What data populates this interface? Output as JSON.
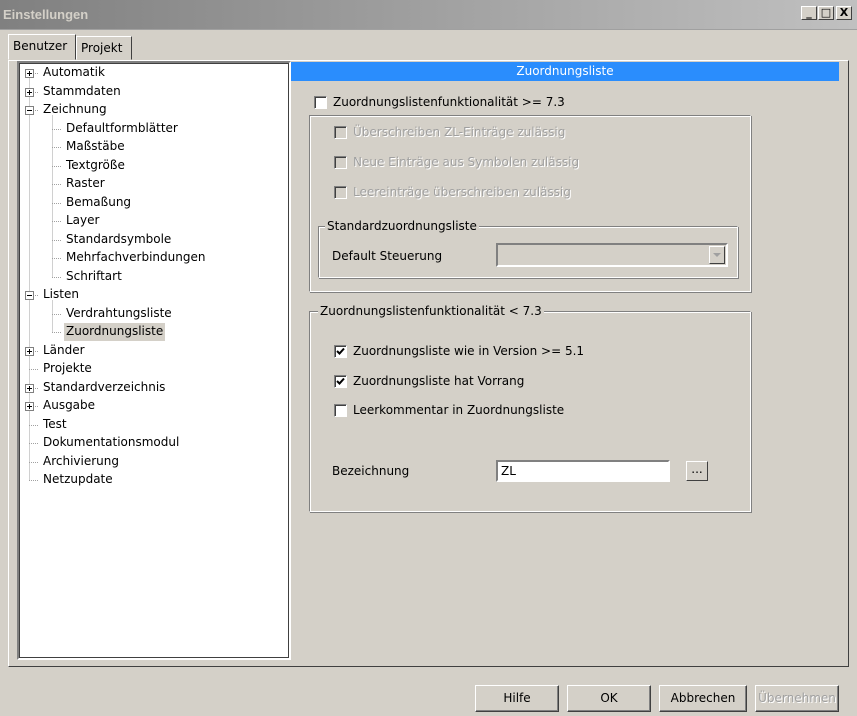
{
  "window": {
    "title": "Einstellungen",
    "controls": {
      "minimize": "_",
      "maximize": "□",
      "close": "X"
    }
  },
  "tabs": [
    {
      "label": "Benutzer",
      "active": true
    },
    {
      "label": "Projekt",
      "active": false
    }
  ],
  "tree": {
    "items": [
      {
        "label": "Automatik",
        "level": 0,
        "expander": "plus"
      },
      {
        "label": "Stammdaten",
        "level": 0,
        "expander": "plus"
      },
      {
        "label": "Zeichnung",
        "level": 0,
        "expander": "minus"
      },
      {
        "label": "Defaultformblätter",
        "level": 1,
        "expander": "none"
      },
      {
        "label": "Maßstäbe",
        "level": 1,
        "expander": "none"
      },
      {
        "label": "Textgröße",
        "level": 1,
        "expander": "none"
      },
      {
        "label": "Raster",
        "level": 1,
        "expander": "none"
      },
      {
        "label": "Bemaßung",
        "level": 1,
        "expander": "none"
      },
      {
        "label": "Layer",
        "level": 1,
        "expander": "none"
      },
      {
        "label": "Standardsymbole",
        "level": 1,
        "expander": "none"
      },
      {
        "label": "Mehrfachverbindungen",
        "level": 1,
        "expander": "none"
      },
      {
        "label": "Schriftart",
        "level": 1,
        "expander": "none"
      },
      {
        "label": "Listen",
        "level": 0,
        "expander": "minus"
      },
      {
        "label": "Verdrahtungsliste",
        "level": 1,
        "expander": "none"
      },
      {
        "label": "Zuordnungsliste",
        "level": 1,
        "expander": "none",
        "selected": true
      },
      {
        "label": "Länder",
        "level": 0,
        "expander": "plus"
      },
      {
        "label": "Projekte",
        "level": 0,
        "expander": "none"
      },
      {
        "label": "Standardverzeichnis",
        "level": 0,
        "expander": "plus"
      },
      {
        "label": "Ausgabe",
        "level": 0,
        "expander": "plus"
      },
      {
        "label": "Test",
        "level": 0,
        "expander": "none"
      },
      {
        "label": "Dokumentationsmodul",
        "level": 0,
        "expander": "none"
      },
      {
        "label": "Archivierung",
        "level": 0,
        "expander": "none"
      },
      {
        "label": "Netzupdate",
        "level": 0,
        "expander": "none"
      }
    ]
  },
  "content": {
    "header": "Zuordnungsliste",
    "func_ge_73": {
      "label": "Zuordnungslistenfunktionalität >= 7.3",
      "checked": false
    },
    "group1": {
      "options": [
        {
          "label": "Überschreiben ZL-Einträge zulässig",
          "checked": false,
          "disabled": true
        },
        {
          "label": "Neue Einträge aus Symbolen zulässig",
          "checked": false,
          "disabled": true
        },
        {
          "label": "Leereinträge überschreiben zulässig",
          "checked": false,
          "disabled": true
        }
      ],
      "standard": {
        "legend": "Standardzuordnungsliste",
        "default_label": "Default Steuerung",
        "default_value": ""
      }
    },
    "group2": {
      "legend": "Zuordnungslistenfunktionalität < 7.3",
      "options": [
        {
          "label": "Zuordnungsliste wie in Version >= 5.1",
          "checked": true
        },
        {
          "label": "Zuordnungsliste hat Vorrang",
          "checked": true
        },
        {
          "label": "Leerkommentar in Zuordnungsliste",
          "checked": false
        }
      ],
      "bezeichnung_label": "Bezeichnung",
      "bezeichnung_value": "ZL",
      "browse_label": "..."
    }
  },
  "buttons": {
    "help": "Hilfe",
    "ok": "OK",
    "cancel": "Abbrechen",
    "apply": "Übernehmen"
  },
  "colors": {
    "face": "#d4d0c8",
    "header_bar": "#2a8dfd",
    "title_gradient_start": "#808080",
    "title_gradient_end": "#c0c0c0"
  }
}
